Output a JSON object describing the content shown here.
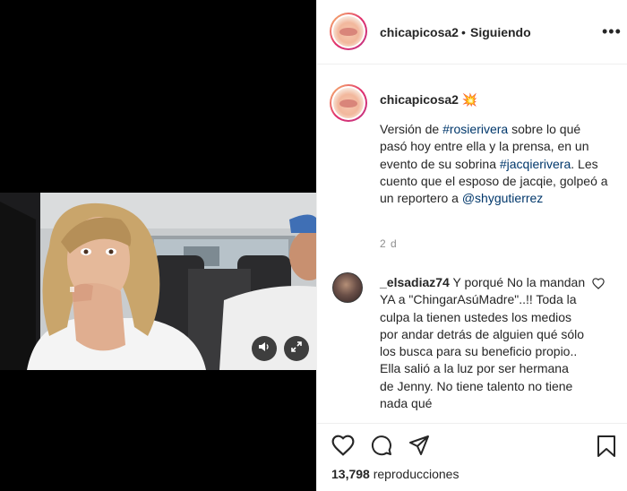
{
  "post": {
    "username": "chicapicosa2",
    "separator": "•",
    "follow_status": "Siguiendo",
    "more_icon": "more-options-icon",
    "caption": {
      "username": "chicapicosa2",
      "emoji": "💥",
      "line1_a": "Versión de ",
      "tag1": "#rosierivera",
      "line1_b": " sobre lo qué pasó hoy entre ella y la prensa, en un evento de su sobrina ",
      "tag2": "#jacqierivera",
      "line1_c": ". Les cuento que el esposo de jacqie, golpeó a un reportero a ",
      "tag3": "@shygutierrez"
    },
    "age": "2 d",
    "comment": {
      "username": "_elsadiaz74",
      "text": " Y porqué No la mandan YA a \"ChingarAsúMadre\"..!! Toda la culpa la tienen ustedes los medios por andar detrás de alguien qué sólo los busca para su beneficio propio.. Ella salió a la luz por ser hermana de Jenny. No tiene talento no tiene nada qué"
    },
    "views_count": "13,798",
    "views_label": "reproducciones"
  },
  "colors": {
    "link": "#00376b",
    "border": "#efefef",
    "muted": "#8e8e8e"
  }
}
